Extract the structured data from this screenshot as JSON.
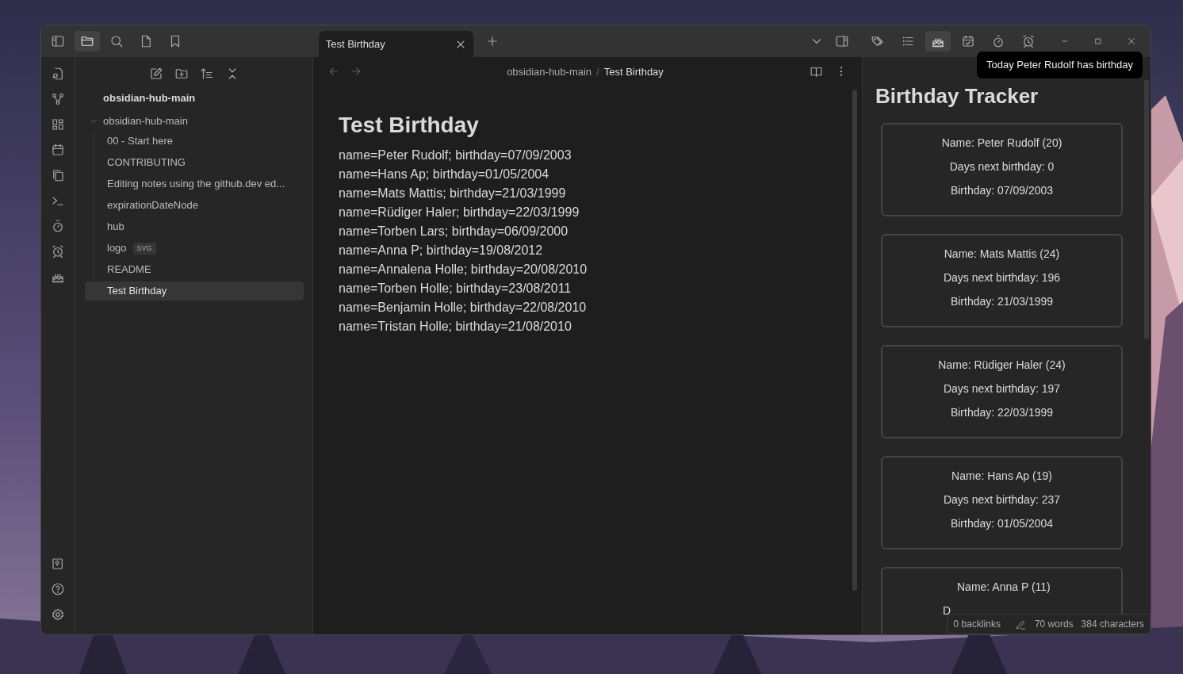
{
  "sidebar_tabs": [
    {
      "selected": true
    },
    {
      "selected": false
    },
    {
      "selected": false
    },
    {
      "selected": false
    }
  ],
  "file_explorer": {
    "vault": "obsidian-hub-main",
    "tree": [
      {
        "name": "obsidian-hub-main",
        "expanded": true,
        "children": [
          {
            "name": "00 - Start here",
            "selected": false
          },
          {
            "name": "CONTRIBUTING",
            "selected": false
          },
          {
            "name": "Editing notes using the github.dev ed...",
            "selected": false
          },
          {
            "name": "expirationDateNode",
            "selected": false
          },
          {
            "name": "hub",
            "selected": false
          },
          {
            "name": "logo",
            "badge": "SVG",
            "selected": false
          },
          {
            "name": "README",
            "selected": false
          },
          {
            "name": "Test Birthday",
            "selected": true
          }
        ]
      }
    ]
  },
  "tabs": [
    {
      "label": "Test Birthday",
      "selected": true
    }
  ],
  "breadcrumb": [
    "obsidian-hub-main",
    "Test Birthday"
  ],
  "breadcrumb_separator": "/",
  "note": {
    "title": "Test Birthday",
    "lines": [
      "name=Peter Rudolf; birthday=07/09/2003",
      "name=Hans Ap; birthday=01/05/2004",
      "name=Mats Mattis; birthday=21/03/1999",
      "name=Rüdiger Haler; birthday=22/03/1999",
      "name=Torben Lars; birthday=06/09/2000",
      "name=Anna P; birthday=19/08/2012",
      "name=Annalena Holle; birthday=20/08/2010",
      "name=Torben Holle; birthday=23/08/2011",
      "name=Benjamin Holle; birthday=22/08/2010",
      "name=Tristan Holle; birthday=21/08/2010"
    ]
  },
  "right_panel_tabs": [
    {
      "selected": false
    },
    {
      "selected": false
    },
    {
      "selected": true
    },
    {
      "selected": false
    },
    {
      "selected": false
    },
    {
      "selected": false
    }
  ],
  "tooltip": "Today Peter Rudolf has birthday",
  "birthday_tracker": {
    "title": "Birthday Tracker",
    "cards": [
      {
        "name": "Name: Peter Rudolf (20)",
        "days": "Days next birthday: 0",
        "birthday": "Birthday: 07/09/2003"
      },
      {
        "name": "Name: Mats Mattis (24)",
        "days": "Days next birthday: 196",
        "birthday": "Birthday: 21/03/1999"
      },
      {
        "name": "Name: Rüdiger Haler (24)",
        "days": "Days next birthday: 197",
        "birthday": "Birthday: 22/03/1999"
      },
      {
        "name": "Name: Hans Ap (19)",
        "days": "Days next birthday: 237",
        "birthday": "Birthday: 01/05/2004"
      },
      {
        "name": "Name: Anna P (11)",
        "days": "D",
        "cut": true
      }
    ]
  },
  "status_bar": {
    "backlinks": "0 backlinks",
    "words": "70 words",
    "characters": "384 characters"
  }
}
